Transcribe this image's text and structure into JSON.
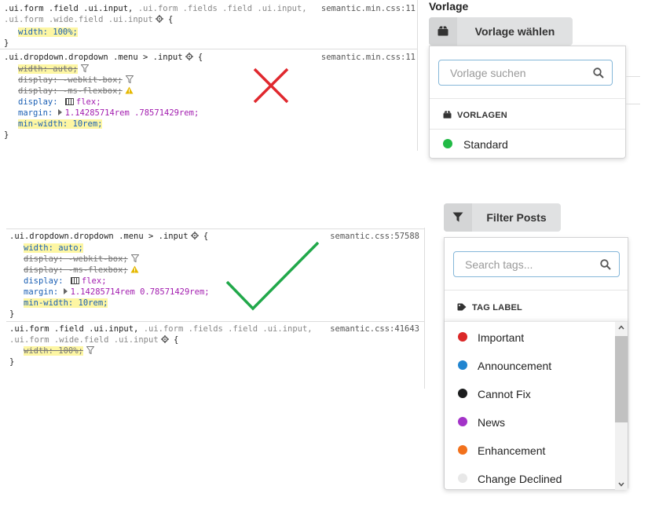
{
  "top_css": {
    "rule1": {
      "selector_line1_main": ".ui.form .field .ui.input,",
      "selector_line1_dim": " .ui.form .fields .field .ui.input,",
      "selector_line2_dim": ".ui.form .wide.field .ui.input",
      "brace_open": " {",
      "source": "semantic.min.css:11",
      "decl1": "width: 100%;",
      "brace_close": "}"
    },
    "rule2": {
      "selector": ".ui.dropdown.dropdown .menu > .input",
      "brace_open": " {",
      "source": "semantic.min.css:11",
      "decl_width": "width: auto;",
      "decl_display1": "display: -webkit-box;",
      "decl_display2": "display: -ms-flexbox;",
      "decl_display3_prop": "display:",
      "decl_display3_val": "flex;",
      "decl_margin_prop": "margin:",
      "decl_margin_val": "1.14285714rem .78571429rem;",
      "decl_minwidth": "min-width: 10rem;",
      "brace_close": "}"
    }
  },
  "bottom_css": {
    "rule1": {
      "selector": ".ui.dropdown.dropdown .menu > .input",
      "brace_open": " {",
      "source": "semantic.css:57588",
      "decl_width": "width: auto;",
      "decl_display1": "display: -webkit-box;",
      "decl_display2": "display: -ms-flexbox;",
      "decl_display3_prop": "display:",
      "decl_display3_val": "flex;",
      "decl_margin_prop": "margin:",
      "decl_margin_val": "1.14285714rem 0.78571429rem;",
      "decl_minwidth": "min-width: 10rem;",
      "brace_close": "}"
    },
    "rule2": {
      "selector_line1_main": ".ui.form .field .ui.input,",
      "selector_line1_dim": " .ui.form .fields .field .ui.input,",
      "selector_line2_dim": ".ui.form .wide.field .ui.input",
      "brace_open": " {",
      "source": "semantic.css:41643",
      "decl1": "width: 100%;",
      "brace_close": "}"
    }
  },
  "vorlage": {
    "heading": "Vorlage",
    "button_label": "Vorlage wählen",
    "search_placeholder": "Vorlage suchen",
    "header": "VORLAGEN",
    "items": [
      {
        "label": "Standard",
        "color": "#21ba45"
      }
    ]
  },
  "filter": {
    "button_label": "Filter Posts",
    "search_placeholder": "Search tags...",
    "header": "TAG LABEL",
    "items": [
      {
        "label": "Important",
        "color": "#db2828"
      },
      {
        "label": "Announcement",
        "color": "#2185d0"
      },
      {
        "label": "Cannot Fix",
        "color": "#1b1c1d"
      },
      {
        "label": "News",
        "color": "#a333c8"
      },
      {
        "label": "Enhancement",
        "color": "#f2711c"
      },
      {
        "label": "Change Declined",
        "color": "#e8e8e8"
      }
    ]
  },
  "annotations": {
    "wrong_mark_color": "#e0282e",
    "right_mark_color": "#21a84a"
  }
}
